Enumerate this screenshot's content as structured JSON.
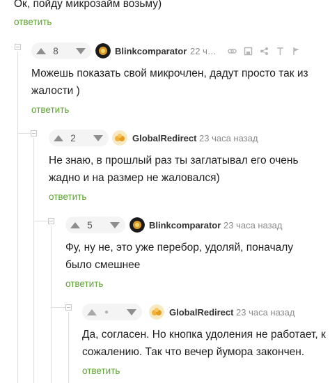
{
  "top_fragment": {
    "text": "Ок, пойду микрозайм возьму)",
    "reply_label": "ответить"
  },
  "comments": [
    {
      "rating": "8",
      "author": "Blinkcomparator",
      "time": "22 ч…",
      "lines": [
        "Можешь показать свой микрочлен, дадут просто так из",
        "жалости )"
      ],
      "reply_label": "ответить",
      "actions": [
        "link-icon",
        "save-icon",
        "share-icon",
        "pin-icon",
        "report-icon"
      ]
    },
    {
      "rating": "2",
      "author": "GlobalRedirect",
      "time": "23 часа назад",
      "lines": [
        "Не знаю, в прошлый раз ты заглатывал его очень",
        "жадно и на размер не жаловался)"
      ],
      "reply_label": "ответить"
    },
    {
      "rating": "5",
      "author": "Blinkcomparator",
      "time": "23 часа назад",
      "lines": [
        "Фу, ну не, это уже перебор, удоляй, поначалу",
        "было смешнее"
      ],
      "reply_label": "ответить"
    },
    {
      "rating": "●",
      "author": "GlobalRedirect",
      "time": "23 часа назад",
      "lines": [
        "Да, согласен. Но кнопка удоления не работает, к",
        "сожалению. Так что вечер йумора закончен."
      ],
      "reply_label": "ответить"
    }
  ],
  "colors": {
    "accent_green": "#5ea331",
    "muted": "#8a8a8a",
    "thread_line": "#dedede"
  }
}
